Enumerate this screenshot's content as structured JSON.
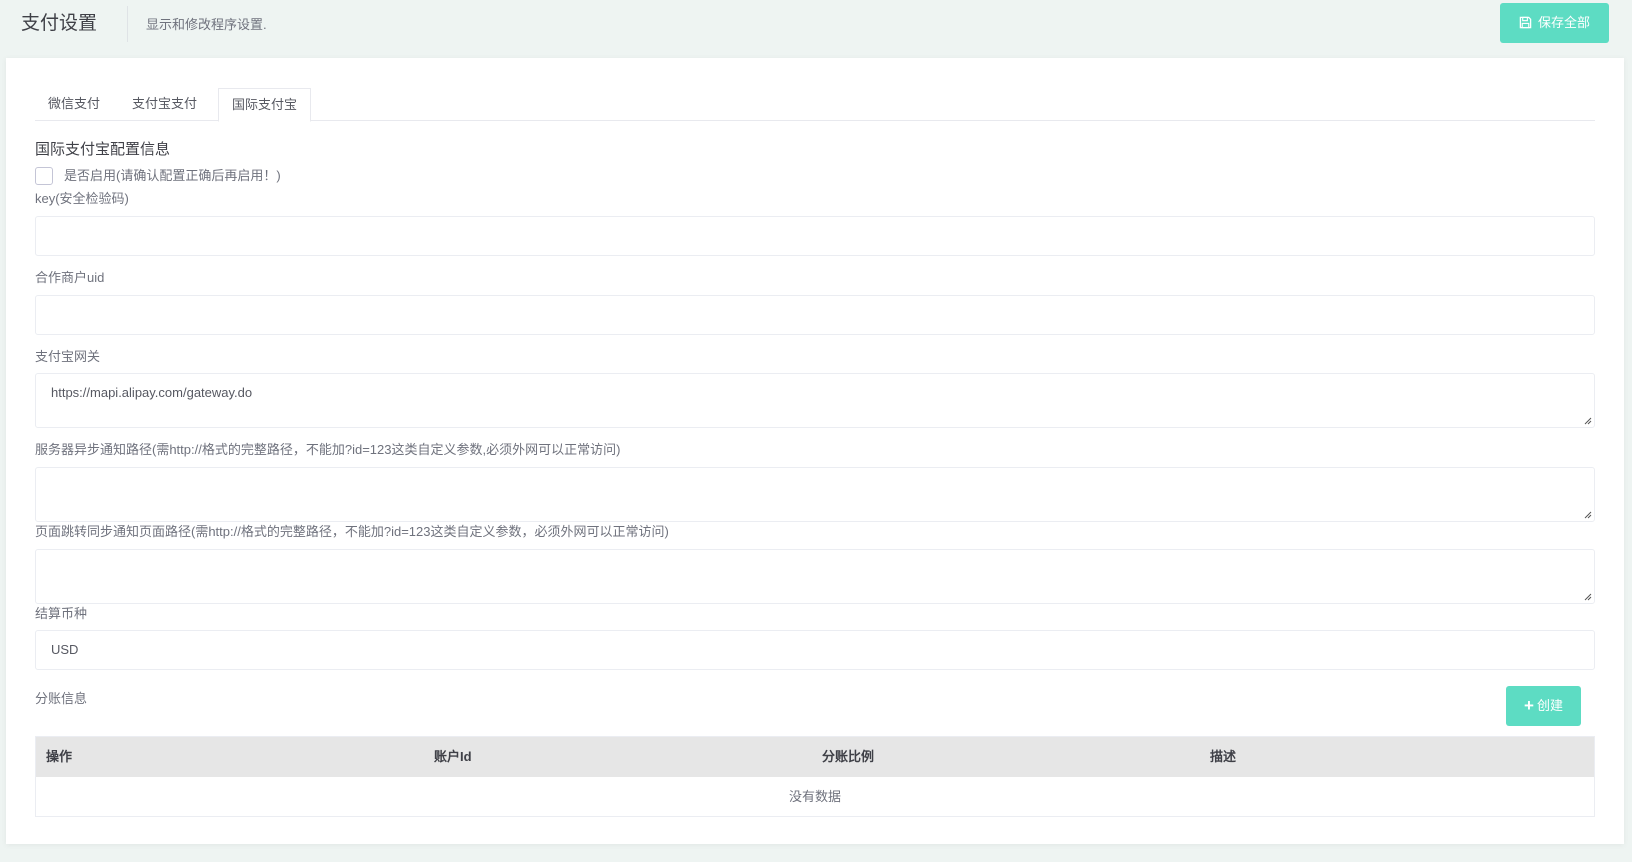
{
  "header": {
    "title": "支付设置",
    "subtitle": "显示和修改程序设置.",
    "save_label": "保存全部",
    "save_icon": "floppy-disk-icon"
  },
  "tabs": [
    {
      "label": "微信支付",
      "active": false
    },
    {
      "label": "支付宝支付",
      "active": false
    },
    {
      "label": "国际支付宝",
      "active": true
    }
  ],
  "form": {
    "section_title": "国际支付宝配置信息",
    "enabled": {
      "label": "是否启用(请确认配置正确后再启用！)",
      "checked": false
    },
    "key": {
      "label": "key(安全检验码)",
      "value": ""
    },
    "partner_uid": {
      "label": "合作商户uid",
      "value": ""
    },
    "gateway": {
      "label": "支付宝网关",
      "value": "https://mapi.alipay.com/gateway.do"
    },
    "notify_url": {
      "label": "服务器异步通知路径(需http://格式的完整路径，不能加?id=123这类自定义参数,必须外网可以正常访问)",
      "value": ""
    },
    "return_url": {
      "label": "页面跳转同步通知页面路径(需http://格式的完整路径，不能加?id=123这类自定义参数，必须外网可以正常访问)",
      "value": ""
    },
    "currency": {
      "label": "结算币种",
      "value": "USD"
    }
  },
  "split": {
    "label": "分账信息",
    "create_label": "创建",
    "columns": [
      "操作",
      "账户Id",
      "分账比例",
      "描述"
    ],
    "rows": [],
    "empty_text": "没有数据"
  },
  "colors": {
    "accent": "#5ddcc3",
    "page_bg": "#eef4f2",
    "table_header_bg": "#e6e6e6"
  }
}
